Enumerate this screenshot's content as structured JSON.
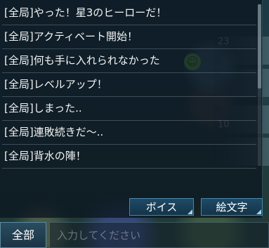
{
  "background": {
    "numbers": [
      "23",
      "10"
    ]
  },
  "chat": {
    "messages": [
      {
        "text": "[全局]やった！星3のヒーローだ！"
      },
      {
        "text": "[全局]アクティベート開始！"
      },
      {
        "text": "[全局]何も手に入れられなかった"
      },
      {
        "text": "[全局]レベルアップ！"
      },
      {
        "text": "[全局]しまった.."
      },
      {
        "text": "[全局]連敗続きだ〜.."
      },
      {
        "text": "[全局]背水の陣！"
      }
    ]
  },
  "buttons": {
    "voice_label": "ボイス",
    "emoji_label": "絵文字"
  },
  "input_bar": {
    "channel_label": "全部",
    "placeholder": "入力してください"
  },
  "colors": {
    "panel": "#0c1620",
    "button_border": "#4a86a8",
    "text": "#f4f4f4"
  }
}
